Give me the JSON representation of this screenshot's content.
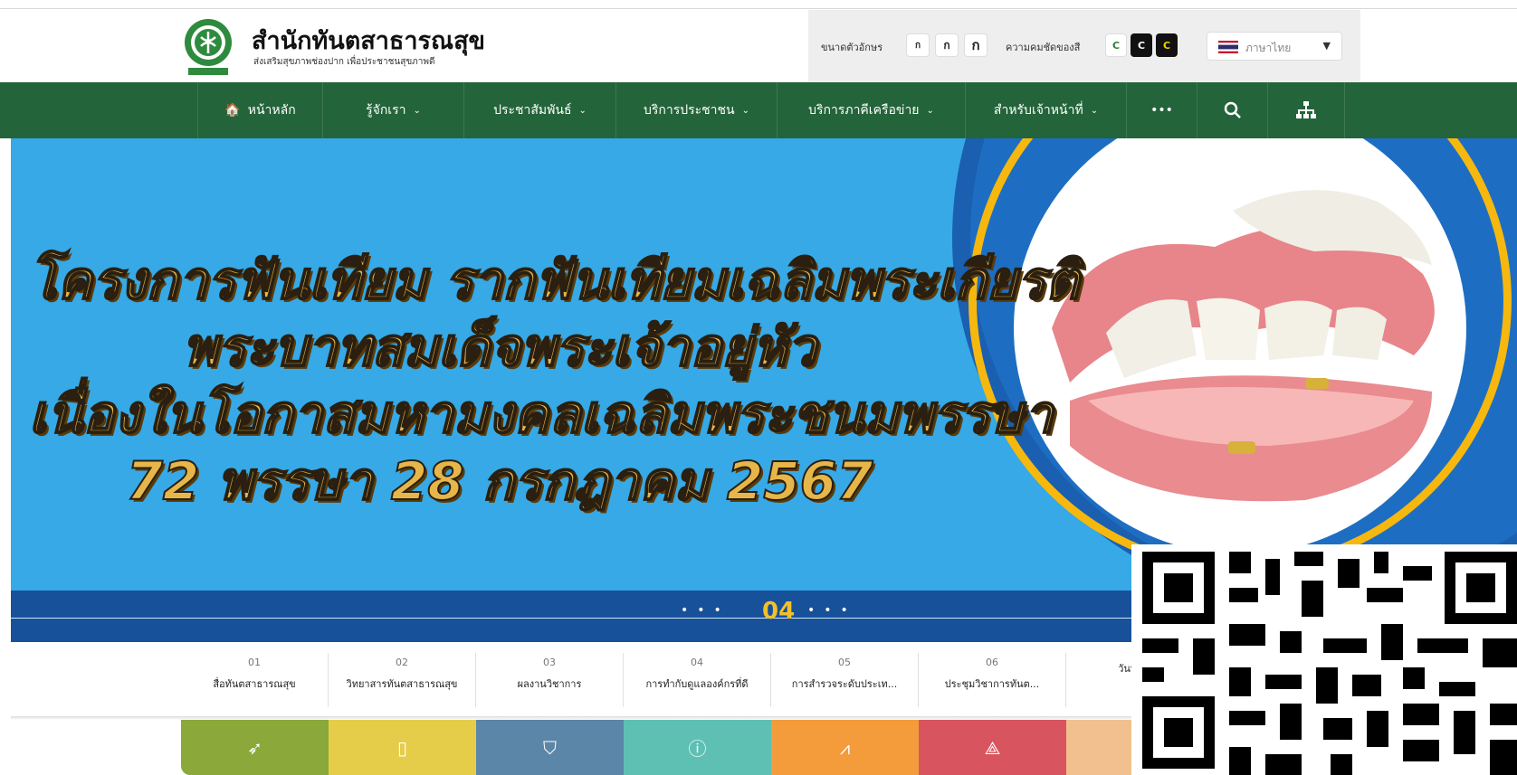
{
  "header": {
    "title": "สำนักทันตสาธารณสุข",
    "subtitle": "ส่งเสริมสุขภาพช่องปาก เพื่อประชาชนสุขภาพดี",
    "font_size_label": "ขนาดตัวอักษร",
    "font_size_buttons": [
      "ก",
      "ก",
      "ก"
    ],
    "contrast_label": "ความคมชัดของสี",
    "contrast_buttons": [
      "C",
      "C",
      "C"
    ],
    "language": "ภาษาไทย"
  },
  "nav": {
    "items": [
      {
        "label": "หน้าหลัก",
        "icon": "home-icon"
      },
      {
        "label": "รู้จักเรา",
        "icon": "chevron-down-icon"
      },
      {
        "label": "ประชาสัมพันธ์",
        "icon": "chevron-down-icon"
      },
      {
        "label": "บริการประชาชน",
        "icon": "chevron-down-icon"
      },
      {
        "label": "บริการภาคีเครือข่าย",
        "icon": "chevron-down-icon"
      },
      {
        "label": "สำหรับเจ้าหน้าที่",
        "icon": "chevron-down-icon"
      }
    ],
    "more": "•••",
    "search_icon": "search-icon",
    "sitemap_icon": "sitemap-icon"
  },
  "banner": {
    "headline_lines": [
      "โครงการฟันเทียม รากฟันเทียมเฉลิมพระเกียรติ",
      "พระบาทสมเด็จพระเจ้าอยู่หัว",
      "เนื่องในโอกาสมหามงคลเฉลิมพระชนมพรรษา",
      "72 พรรษา 28 กรกฎาคม 2567"
    ],
    "slide_number": "04",
    "image_icon": "denture-image"
  },
  "slides": [
    {
      "num": "01",
      "title": "สื่อทันตสาธารณสุข"
    },
    {
      "num": "02",
      "title": "วิทยาสารทันตสาธารณสุข"
    },
    {
      "num": "03",
      "title": "ผลงานวิชาการ"
    },
    {
      "num": "04",
      "title": "การทำกับดูแลองค์กรที่ดี"
    },
    {
      "num": "05",
      "title": "การสำรวจระดับประเท..."
    },
    {
      "num": "06",
      "title": "ประชุมวิชาการทันต..."
    },
    {
      "num": "",
      "title": "วันทันตสา"
    }
  ],
  "tiles": [
    {
      "color": "#8aa93a",
      "icon": "arrow-icon"
    },
    {
      "color": "#e5cd4a",
      "icon": "document-icon"
    },
    {
      "color": "#5b86a8",
      "icon": "shield-icon"
    },
    {
      "color": "#5ec0b3",
      "icon": "info-icon"
    },
    {
      "color": "#f49b3c",
      "icon": "chart-icon"
    },
    {
      "color": "#d8555f",
      "icon": "link-icon"
    },
    {
      "color": "#f1c08e",
      "icon": "star-icon"
    }
  ],
  "colors": {
    "nav": "#24643a",
    "banner": "#36a9e6",
    "headline": "#e7b64a",
    "slide_number": "#f2c029"
  }
}
